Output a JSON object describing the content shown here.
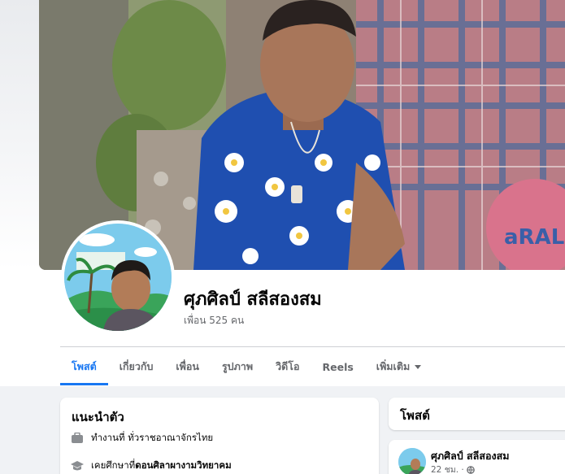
{
  "profile": {
    "name": "ศุภศิลป์ สลีสองสม",
    "friends": "เพื่อน 525 คน"
  },
  "tabs": [
    {
      "label": "โพสต์",
      "active": true
    },
    {
      "label": "เกี่ยวกับ",
      "active": false
    },
    {
      "label": "เพื่อน",
      "active": false
    },
    {
      "label": "รูปภาพ",
      "active": false
    },
    {
      "label": "วิดีโอ",
      "active": false
    },
    {
      "label": "Reels",
      "active": false
    },
    {
      "label": "เพิ่มเติม",
      "active": false
    }
  ],
  "intro": {
    "title": "แนะนำตัว",
    "work": "ทำงานที่ ทั่วราชอาณาจักรไทย",
    "study_prefix": "เคยศึกษาที่ ",
    "study_school": "ดอนศิลาผางามวิทยาคม"
  },
  "posts": {
    "title": "โพสต์",
    "author": "ศุภศิลป์ สลีสองสม",
    "time": "22 ชม. ·"
  },
  "colors": {
    "accent": "#1877f2",
    "background": "#f0f2f5",
    "secondary_text": "#65676b"
  }
}
